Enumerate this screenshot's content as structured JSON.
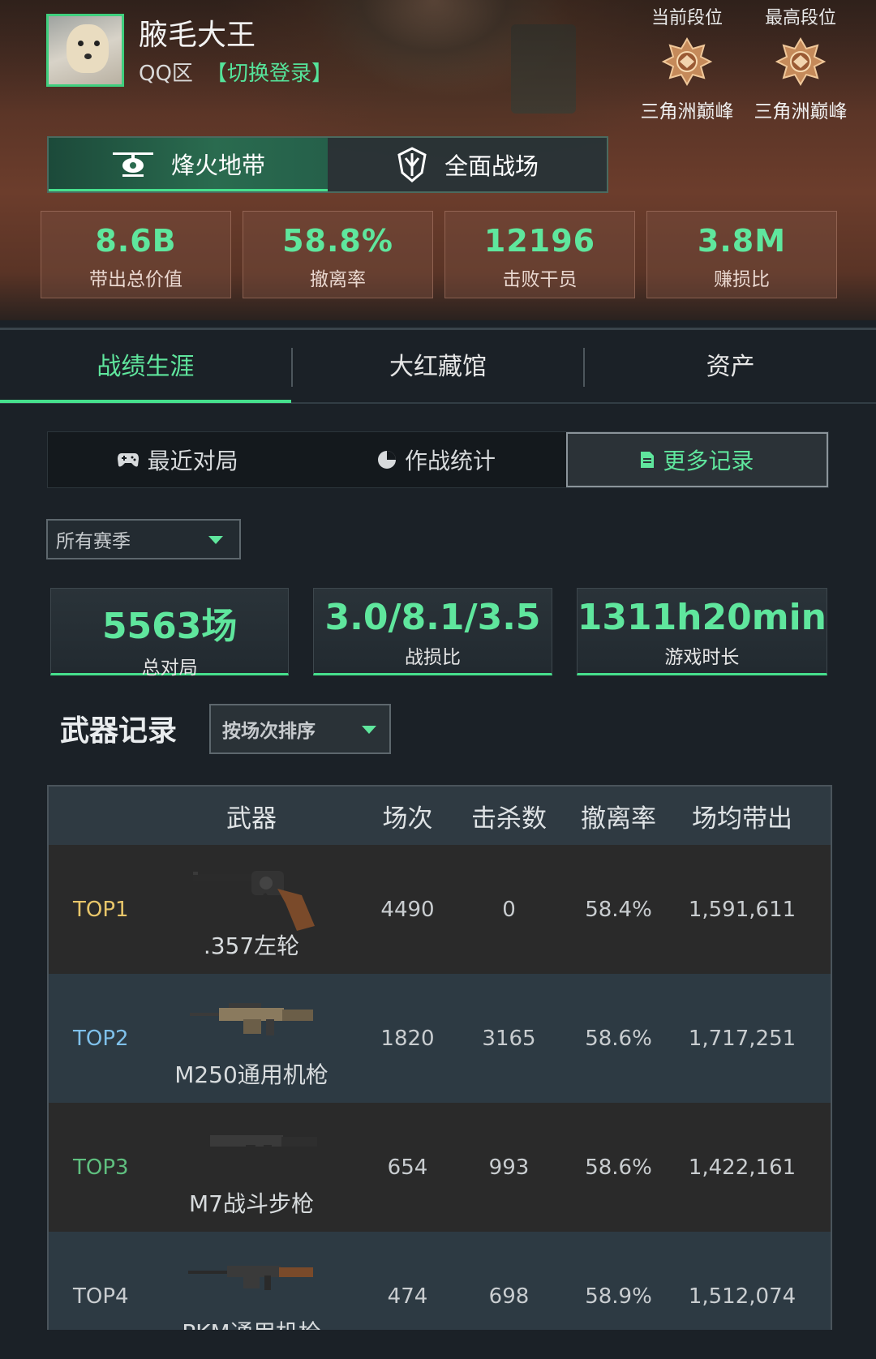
{
  "profile": {
    "username": "腋毛大王",
    "region": "QQ区",
    "switch_login": "【切换登录】"
  },
  "ranks": [
    {
      "title": "当前段位",
      "name": "三角洲巅峰"
    },
    {
      "title": "最高段位",
      "name": "三角洲巅峰"
    }
  ],
  "modes": [
    {
      "label": "烽火地带",
      "icon": "helicopter-icon",
      "active": true
    },
    {
      "label": "全面战场",
      "icon": "shield-emblem-icon",
      "active": false
    }
  ],
  "top_stats": [
    {
      "value": "8.6B",
      "label": "带出总价值"
    },
    {
      "value": "58.8%",
      "label": "撤离率"
    },
    {
      "value": "12196",
      "label": "击败干员"
    },
    {
      "value": "3.8M",
      "label": "赚损比"
    }
  ],
  "tabs": [
    "战绩生涯",
    "大红藏馆",
    "资产"
  ],
  "subtabs": [
    {
      "label": "最近对局",
      "icon": "gamepad-icon"
    },
    {
      "label": "作战统计",
      "icon": "pie-chart-icon"
    },
    {
      "label": "更多记录",
      "icon": "document-icon"
    }
  ],
  "season_filter": "所有赛季",
  "summary_stats": [
    {
      "value": "5563场",
      "label": "总对局"
    },
    {
      "value": "3.0/8.1/3.5",
      "label": "战损比"
    },
    {
      "value": "1311h20min",
      "label": "游戏时长"
    }
  ],
  "weapons_section": {
    "title": "武器记录",
    "sort_label": "按场次排序"
  },
  "table": {
    "headers": [
      "武器",
      "场次",
      "击杀数",
      "撤离率",
      "场均带出"
    ],
    "rows": [
      {
        "rank": "TOP1",
        "rank_color": "#e8c66a",
        "weapon": ".357左轮",
        "matches": "4490",
        "kills": "0",
        "extract_rate": "58.4%",
        "avg_value": "1,591,611"
      },
      {
        "rank": "TOP2",
        "rank_color": "#7fc0ea",
        "weapon": "M250通用机枪",
        "matches": "1820",
        "kills": "3165",
        "extract_rate": "58.6%",
        "avg_value": "1,717,251"
      },
      {
        "rank": "TOP3",
        "rank_color": "#5fbf7f",
        "weapon": "M7战斗步枪",
        "matches": "654",
        "kills": "993",
        "extract_rate": "58.6%",
        "avg_value": "1,422,161"
      },
      {
        "rank": "TOP4",
        "rank_color": "#c9cdd0",
        "weapon": "PKM通用机枪",
        "matches": "474",
        "kills": "698",
        "extract_rate": "58.9%",
        "avg_value": "1,512,074"
      }
    ]
  },
  "colors": {
    "accent": "#5fe69d",
    "panel": "#2a3339"
  }
}
